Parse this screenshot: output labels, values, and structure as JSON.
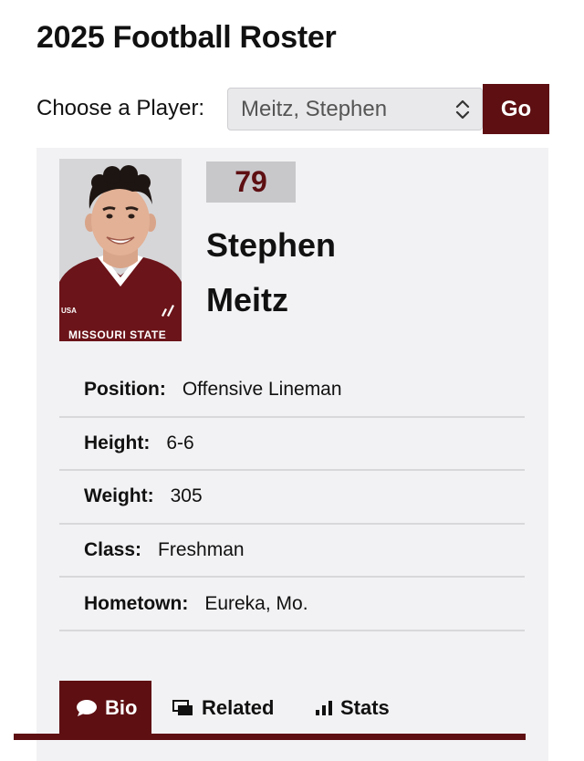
{
  "page": {
    "title": "2025 Football Roster"
  },
  "chooser": {
    "label": "Choose a Player:",
    "selected": "Meitz, Stephen",
    "go_label": "Go"
  },
  "player": {
    "number": "79",
    "first_name": "Stephen",
    "last_name": "Meitz",
    "photo_jersey_text": "MISSOURI STATE",
    "photo_logo_text": "USA"
  },
  "info": [
    {
      "label": "Position:",
      "value": "Offensive Lineman"
    },
    {
      "label": "Height:",
      "value": "6-6"
    },
    {
      "label": "Weight:",
      "value": "305"
    },
    {
      "label": "Class:",
      "value": "Freshman"
    },
    {
      "label": "Hometown:",
      "value": "Eureka, Mo."
    }
  ],
  "tabs": [
    {
      "label": "Bio",
      "icon": "speech-bubble-icon",
      "active": true
    },
    {
      "label": "Related",
      "icon": "stacked-cards-icon",
      "active": false
    },
    {
      "label": "Stats",
      "icon": "bar-chart-icon",
      "active": false
    }
  ],
  "colors": {
    "accent": "#5e0f12",
    "card_bg": "#f2f2f4",
    "badge_bg": "#c8c8cb"
  }
}
